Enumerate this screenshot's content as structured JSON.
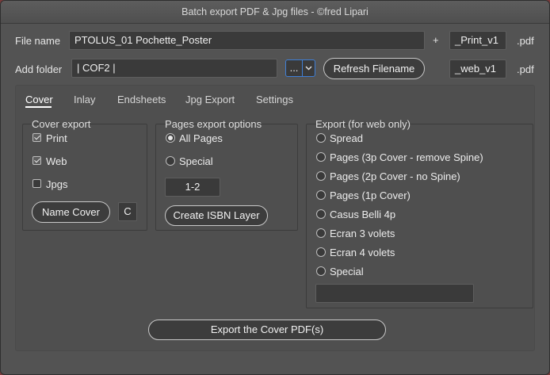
{
  "window": {
    "title": "Batch export PDF & Jpg files - ©fred Lipari"
  },
  "file_row": {
    "label": "File name",
    "value": "PTOLUS_01 Pochette_Poster",
    "plus": "+",
    "suffix": "_Print_v1",
    "ext": ".pdf"
  },
  "folder_row": {
    "label": "Add folder",
    "value": "| COF2 |",
    "dots": "...",
    "refresh_label": "Refresh Filename",
    "suffix": "_web_v1",
    "ext": ".pdf"
  },
  "tabs": [
    {
      "label": "Cover",
      "active": true
    },
    {
      "label": "Inlay"
    },
    {
      "label": "Endsheets"
    },
    {
      "label": "Jpg Export"
    },
    {
      "label": "Settings"
    }
  ],
  "cover_export": {
    "title": "Cover export",
    "options": [
      {
        "label": "Print",
        "checked": true
      },
      {
        "label": "Web",
        "checked": true
      },
      {
        "label": "Jpgs",
        "checked": false
      }
    ],
    "name_cover_label": "Name Cover",
    "letter": "C"
  },
  "pages_export": {
    "title": "Pages export options",
    "options": [
      {
        "label": "All Pages",
        "selected": true
      },
      {
        "label": "Special",
        "selected": false
      }
    ],
    "range": "1-2",
    "isbn_label": "Create ISBN Layer"
  },
  "web_export": {
    "title": "Export (for web only)",
    "options": [
      {
        "label": "Spread"
      },
      {
        "label": "Pages (3p Cover - remove Spine)"
      },
      {
        "label": "Pages (2p Cover - no Spine)"
      },
      {
        "label": "Pages (1p Cover)"
      },
      {
        "label": "Casus Belli 4p"
      },
      {
        "label": "Ecran 3 volets"
      },
      {
        "label": "Ecran 4 volets"
      },
      {
        "label": "Special"
      }
    ],
    "special_value": ""
  },
  "export_button": {
    "label": "Export the Cover PDF(s)"
  }
}
